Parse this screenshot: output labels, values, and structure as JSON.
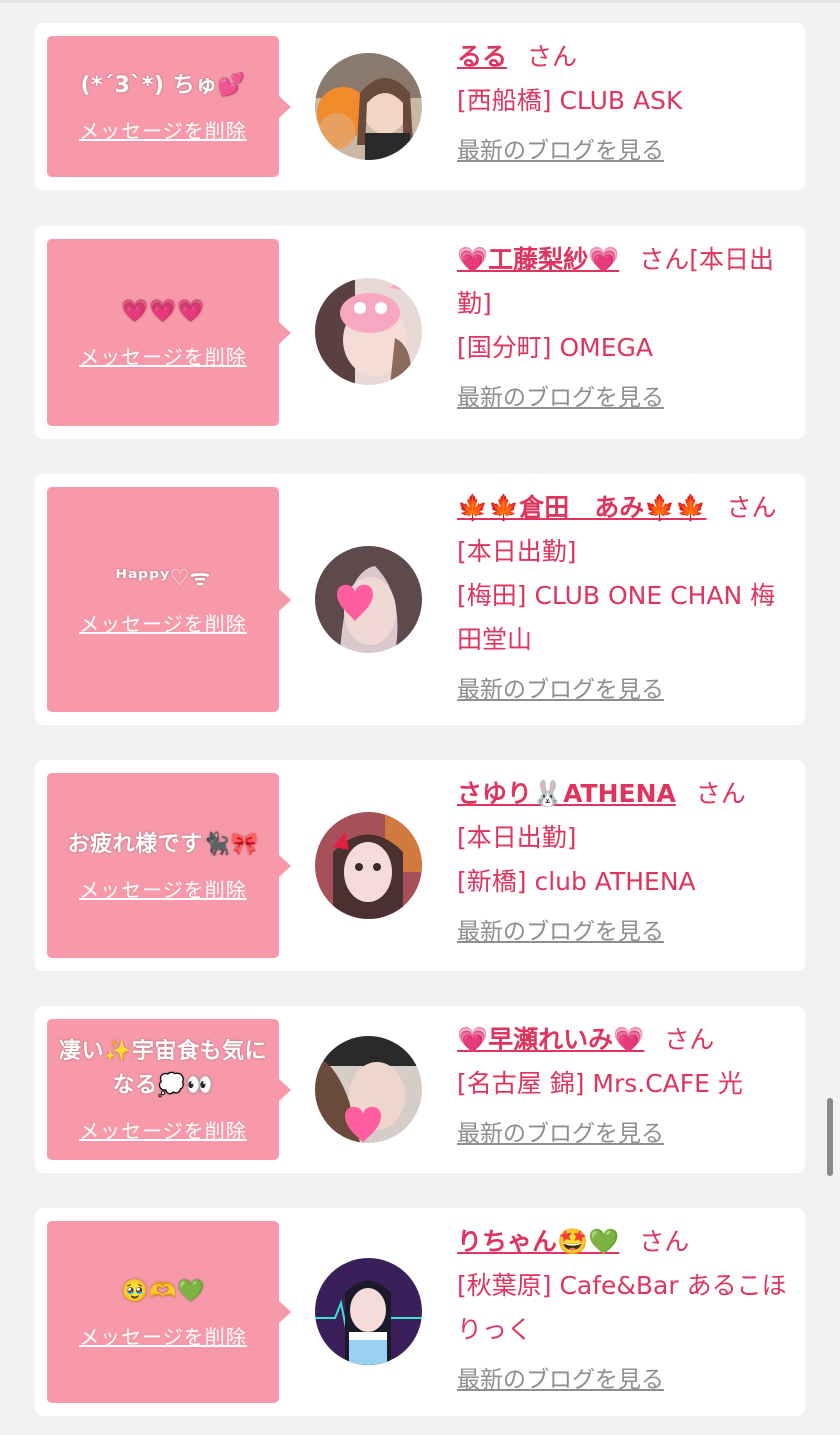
{
  "cards": [
    {
      "message": "(*´3`*) ちゅ💕",
      "delete_label": "メッセージを削除",
      "name": "るる",
      "honorific": "さん",
      "status": "",
      "shop": "[西船橋] CLUB ASK",
      "blog_label": "最新のブログを見る"
    },
    {
      "message": "💗💗💗",
      "delete_label": "メッセージを削除",
      "name": "💗工藤梨紗💗",
      "honorific": "さん",
      "status": "[本日出勤]",
      "shop": "[国分町] OMEGA",
      "blog_label": "最新のブログを見る"
    },
    {
      "message": "ᴴᵃᵖᵖʸ♡ᯤ",
      "delete_label": "メッセージを削除",
      "name": "🍁🍁倉田　あみ🍁🍁",
      "honorific": "さん",
      "status": "[本日出勤]",
      "shop": "[梅田] CLUB ONE CHAN 梅田堂山",
      "blog_label": "最新のブログを見る"
    },
    {
      "message": "お疲れ様です🐈‍⬛🎀",
      "delete_label": "メッセージを削除",
      "name": "さゆり🐰ATHENA",
      "honorific": "さん",
      "status": "[本日出勤]",
      "shop": "[新橋] club ATHENA",
      "blog_label": "最新のブログを見る"
    },
    {
      "message": "凄い✨宇宙食も気になる💭👀",
      "delete_label": "メッセージを削除",
      "name": "💗早瀬れいみ💗",
      "honorific": "さん",
      "status": "",
      "shop": "[名古屋 錦] Mrs.CAFE 光",
      "blog_label": "最新のブログを見る"
    },
    {
      "message": "🥹🫶💚",
      "delete_label": "メッセージを削除",
      "name": "りちゃん🤩💚",
      "honorific": "さん",
      "status": "",
      "shop": "[秋葉原] Cafe&Bar あるこほりっく",
      "blog_label": "最新のブログを見る"
    }
  ],
  "colors": {
    "accent": "#e0345e",
    "bubble": "#f799a8",
    "link_gray": "#8e8e8e",
    "background": "#f2f2f2"
  },
  "icons": [
    "avatar-photo"
  ]
}
